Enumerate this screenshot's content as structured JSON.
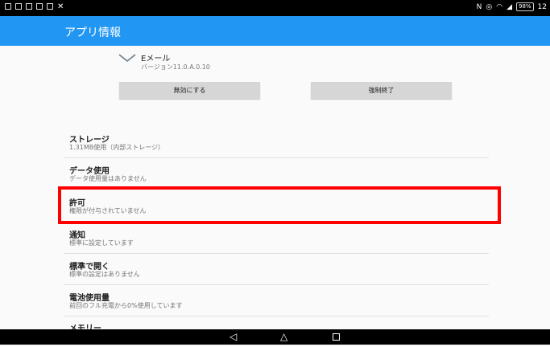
{
  "status_bar": {
    "left_icons": [
      "notification-icon",
      "image-icon",
      "save-icon",
      "doc-icon",
      "list-icon",
      "tool-icon"
    ],
    "nfc": "N",
    "battery": "98%",
    "time": "12"
  },
  "appbar": {
    "title": "アプリ情報"
  },
  "app": {
    "icon": "mail-envelope-icon",
    "name": "Eメール",
    "version": "バージョン11.0.A.0.10"
  },
  "buttons": {
    "disable_label": "無効にする",
    "force_stop_label": "強制終了"
  },
  "settings": [
    {
      "title": "ストレージ",
      "subtitle": "1.31MB使用（内部ストレージ）"
    },
    {
      "title": "データ使用",
      "subtitle": "データ使用量はありません"
    },
    {
      "title": "許可",
      "subtitle": "権限が付与されていません"
    },
    {
      "title": "通知",
      "subtitle": "標準に設定しています"
    },
    {
      "title": "標準で開く",
      "subtitle": "標準の設定はありません"
    },
    {
      "title": "電池使用量",
      "subtitle": "前回のフル充電から0%使用しています"
    },
    {
      "title": "メモリー",
      "subtitle": ""
    }
  ],
  "highlight": {
    "color": "#ff0000",
    "target": "許可"
  },
  "colors": {
    "appbar": "#2196f3",
    "background": "#fafafa"
  },
  "nav": {
    "back": "◁",
    "home": "△",
    "recent": "square-icon"
  }
}
